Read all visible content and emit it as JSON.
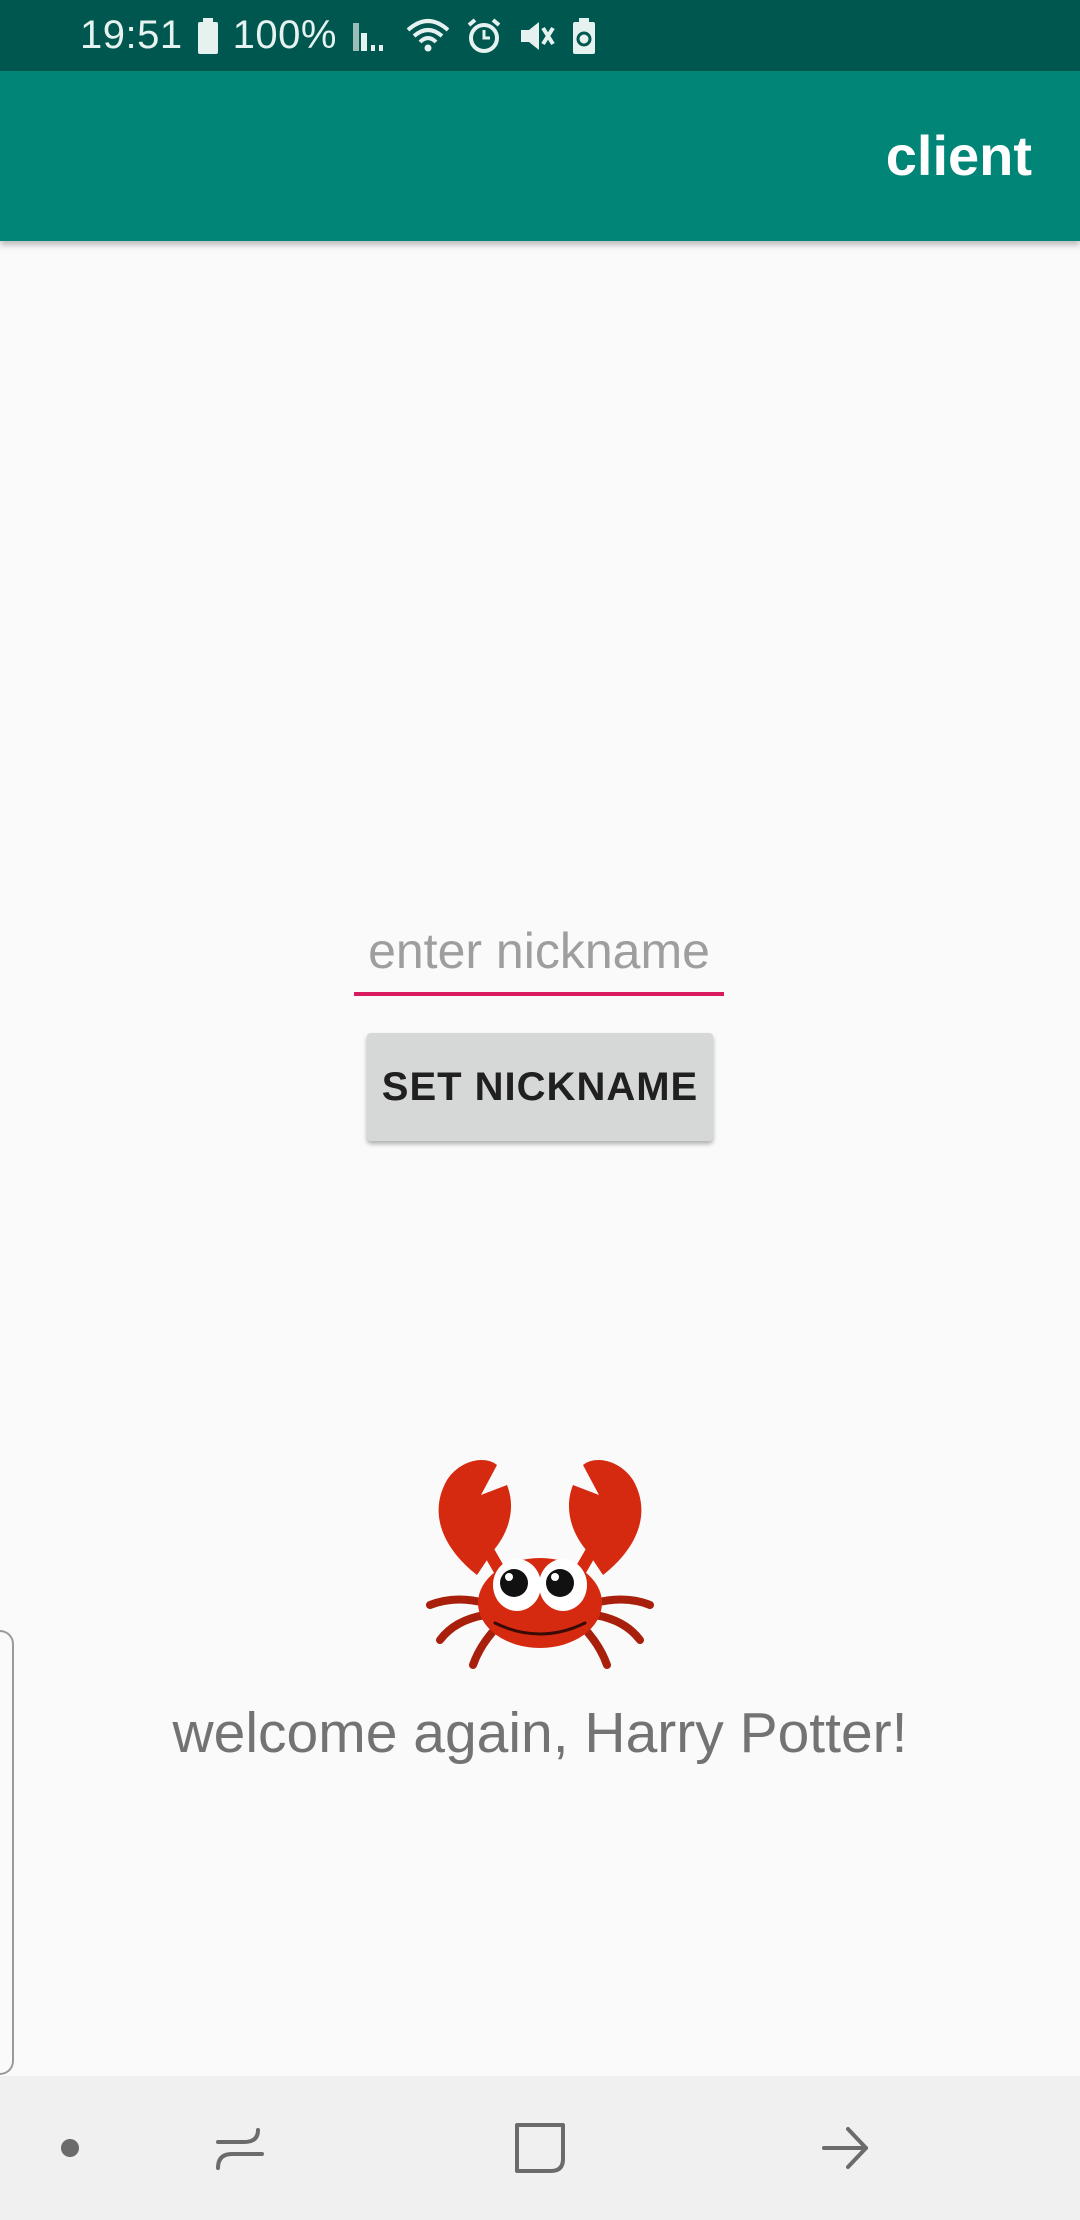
{
  "status_bar": {
    "time": "19:51",
    "battery_percent": "100%",
    "icons": [
      "battery-icon",
      "signal-icon",
      "wifi-icon",
      "alarm-icon",
      "mute-icon",
      "battery-saver-icon"
    ]
  },
  "app_bar": {
    "title": "client"
  },
  "form": {
    "nickname_placeholder": "enter nickname",
    "nickname_value": "",
    "set_button_label": "SET NICKNAME"
  },
  "main": {
    "mascot_icon": "crab-icon",
    "welcome_text": "welcome again, Harry Potter!"
  },
  "nav_bar": {
    "items": [
      "dot-icon",
      "recent-apps-icon",
      "home-icon",
      "back-icon"
    ]
  },
  "colors": {
    "status_bar": "#00574f",
    "app_bar": "#008577",
    "accent": "#d81b60",
    "crab": "#d62a10"
  }
}
